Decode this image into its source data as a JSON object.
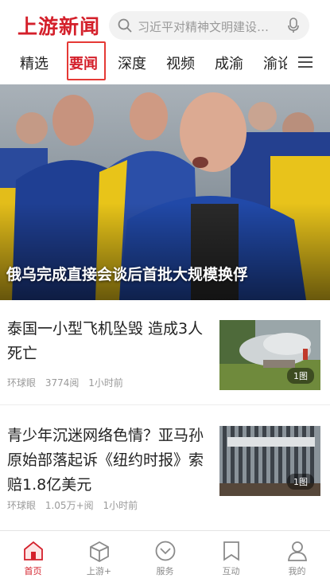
{
  "header": {
    "logo": "上游新闻",
    "search_placeholder": "习近平对精神文明建设…",
    "brand_color": "#d4202b"
  },
  "tabs": [
    {
      "label": "精选",
      "active": false
    },
    {
      "label": "要闻",
      "active": true
    },
    {
      "label": "深度",
      "active": false
    },
    {
      "label": "视频",
      "active": false
    },
    {
      "label": "成渝",
      "active": false
    },
    {
      "label": "渝论",
      "active": false
    }
  ],
  "hero": {
    "caption": "俄乌完成直接会谈后首批大规模换俘"
  },
  "news": [
    {
      "title": "泰国一小型飞机坠毁 造成3人死亡",
      "source": "环球眼",
      "views": "3774阅",
      "time": "1小时前",
      "badge": "1图"
    },
    {
      "title": "青少年沉迷网络色情？亚马孙原始部落起诉《纽约时报》索赔1.8亿美元",
      "source": "环球眼",
      "views": "1.05万+阅",
      "time": "1小时前",
      "badge": "1图"
    }
  ],
  "bottom_nav": [
    {
      "label": "首页",
      "icon": "home-icon",
      "active": true
    },
    {
      "label": "上游+",
      "icon": "cube-icon",
      "active": false
    },
    {
      "label": "服务",
      "icon": "chevron-circle-icon",
      "active": false
    },
    {
      "label": "互动",
      "icon": "bookmark-icon",
      "active": false
    },
    {
      "label": "我的",
      "icon": "person-icon",
      "active": false
    }
  ]
}
